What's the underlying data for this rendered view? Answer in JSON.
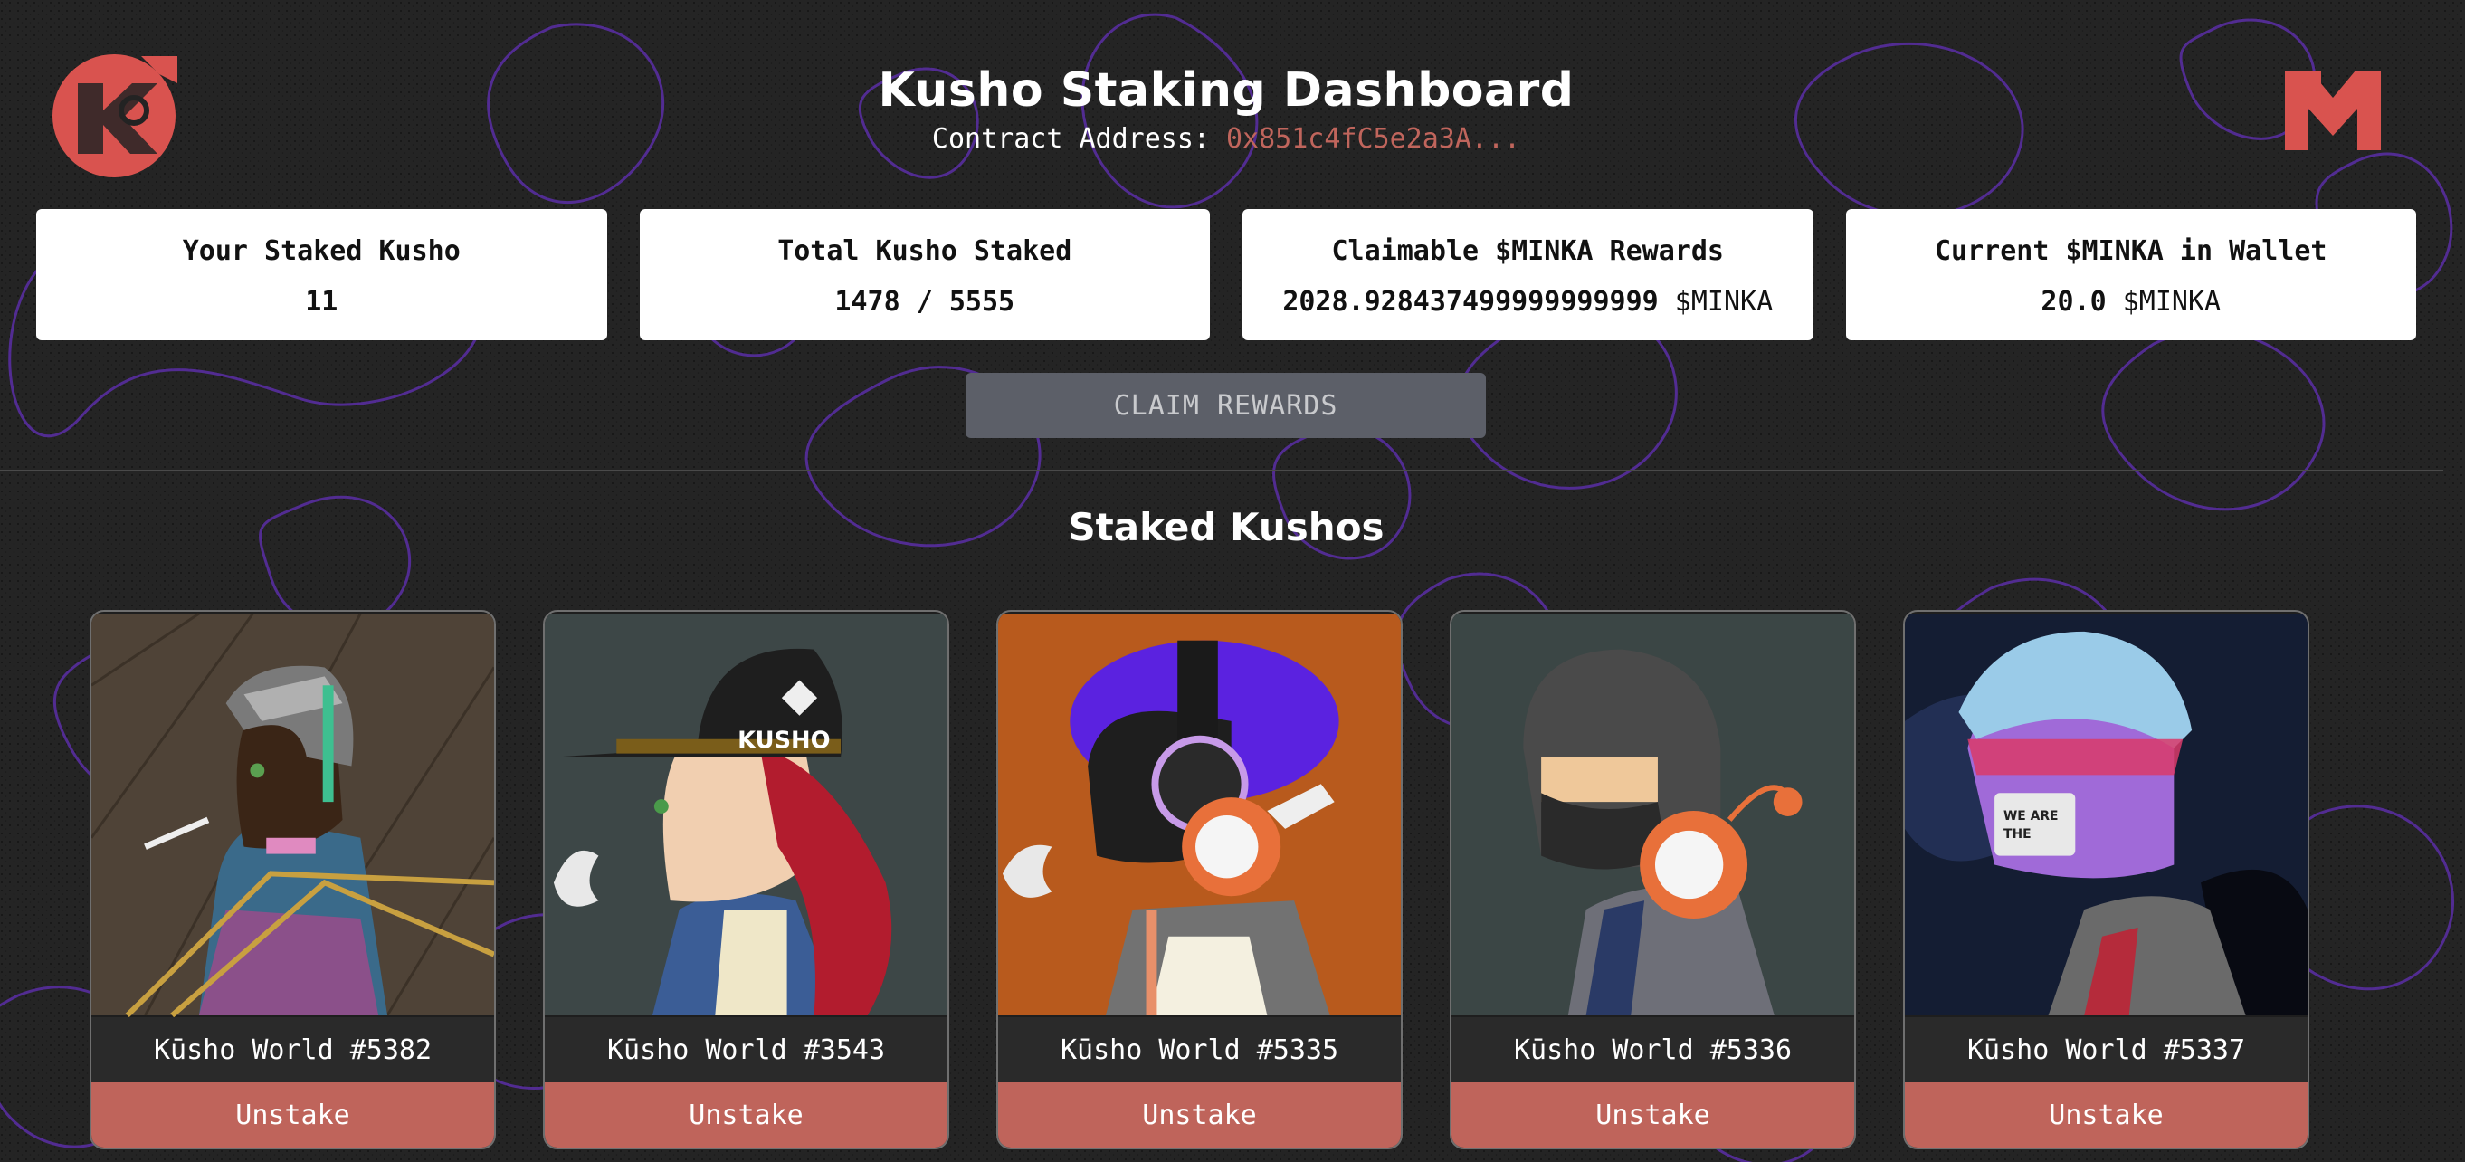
{
  "header": {
    "title": "Kusho Staking Dashboard",
    "contract_label": "Contract Address:",
    "contract_address": "0x851c4fC5e2a3A..."
  },
  "stats": [
    {
      "label": "Your Staked Kusho",
      "value": "11",
      "unit": ""
    },
    {
      "label": "Total Kusho Staked",
      "value": "1478 / 5555",
      "unit": ""
    },
    {
      "label": "Claimable $MINKA Rewards",
      "value": "2028.928437499999999999",
      "unit": "$MINKA"
    },
    {
      "label": "Current $MINKA in Wallet",
      "value": "20.0",
      "unit": "$MINKA"
    }
  ],
  "claim_button": "CLAIM REWARDS",
  "section_title": "Staked Kushos",
  "nfts": [
    {
      "name": "Kūsho World #5382",
      "action": "Unstake",
      "bg": "#4f4337"
    },
    {
      "name": "Kūsho World #3543",
      "action": "Unstake",
      "bg": "#3d4747"
    },
    {
      "name": "Kūsho World #5335",
      "action": "Unstake",
      "bg": "#b85a1d"
    },
    {
      "name": "Kūsho World #5336",
      "action": "Unstake",
      "bg": "#3b4645"
    },
    {
      "name": "Kūsho World #5337",
      "action": "Unstake",
      "bg": "#141d33"
    }
  ],
  "colors": {
    "accent": "#c0655c",
    "unstake": "#bf645b",
    "claim_disabled": "#5c5f68",
    "background": "#232323",
    "pattern": "#5a2ea6"
  }
}
